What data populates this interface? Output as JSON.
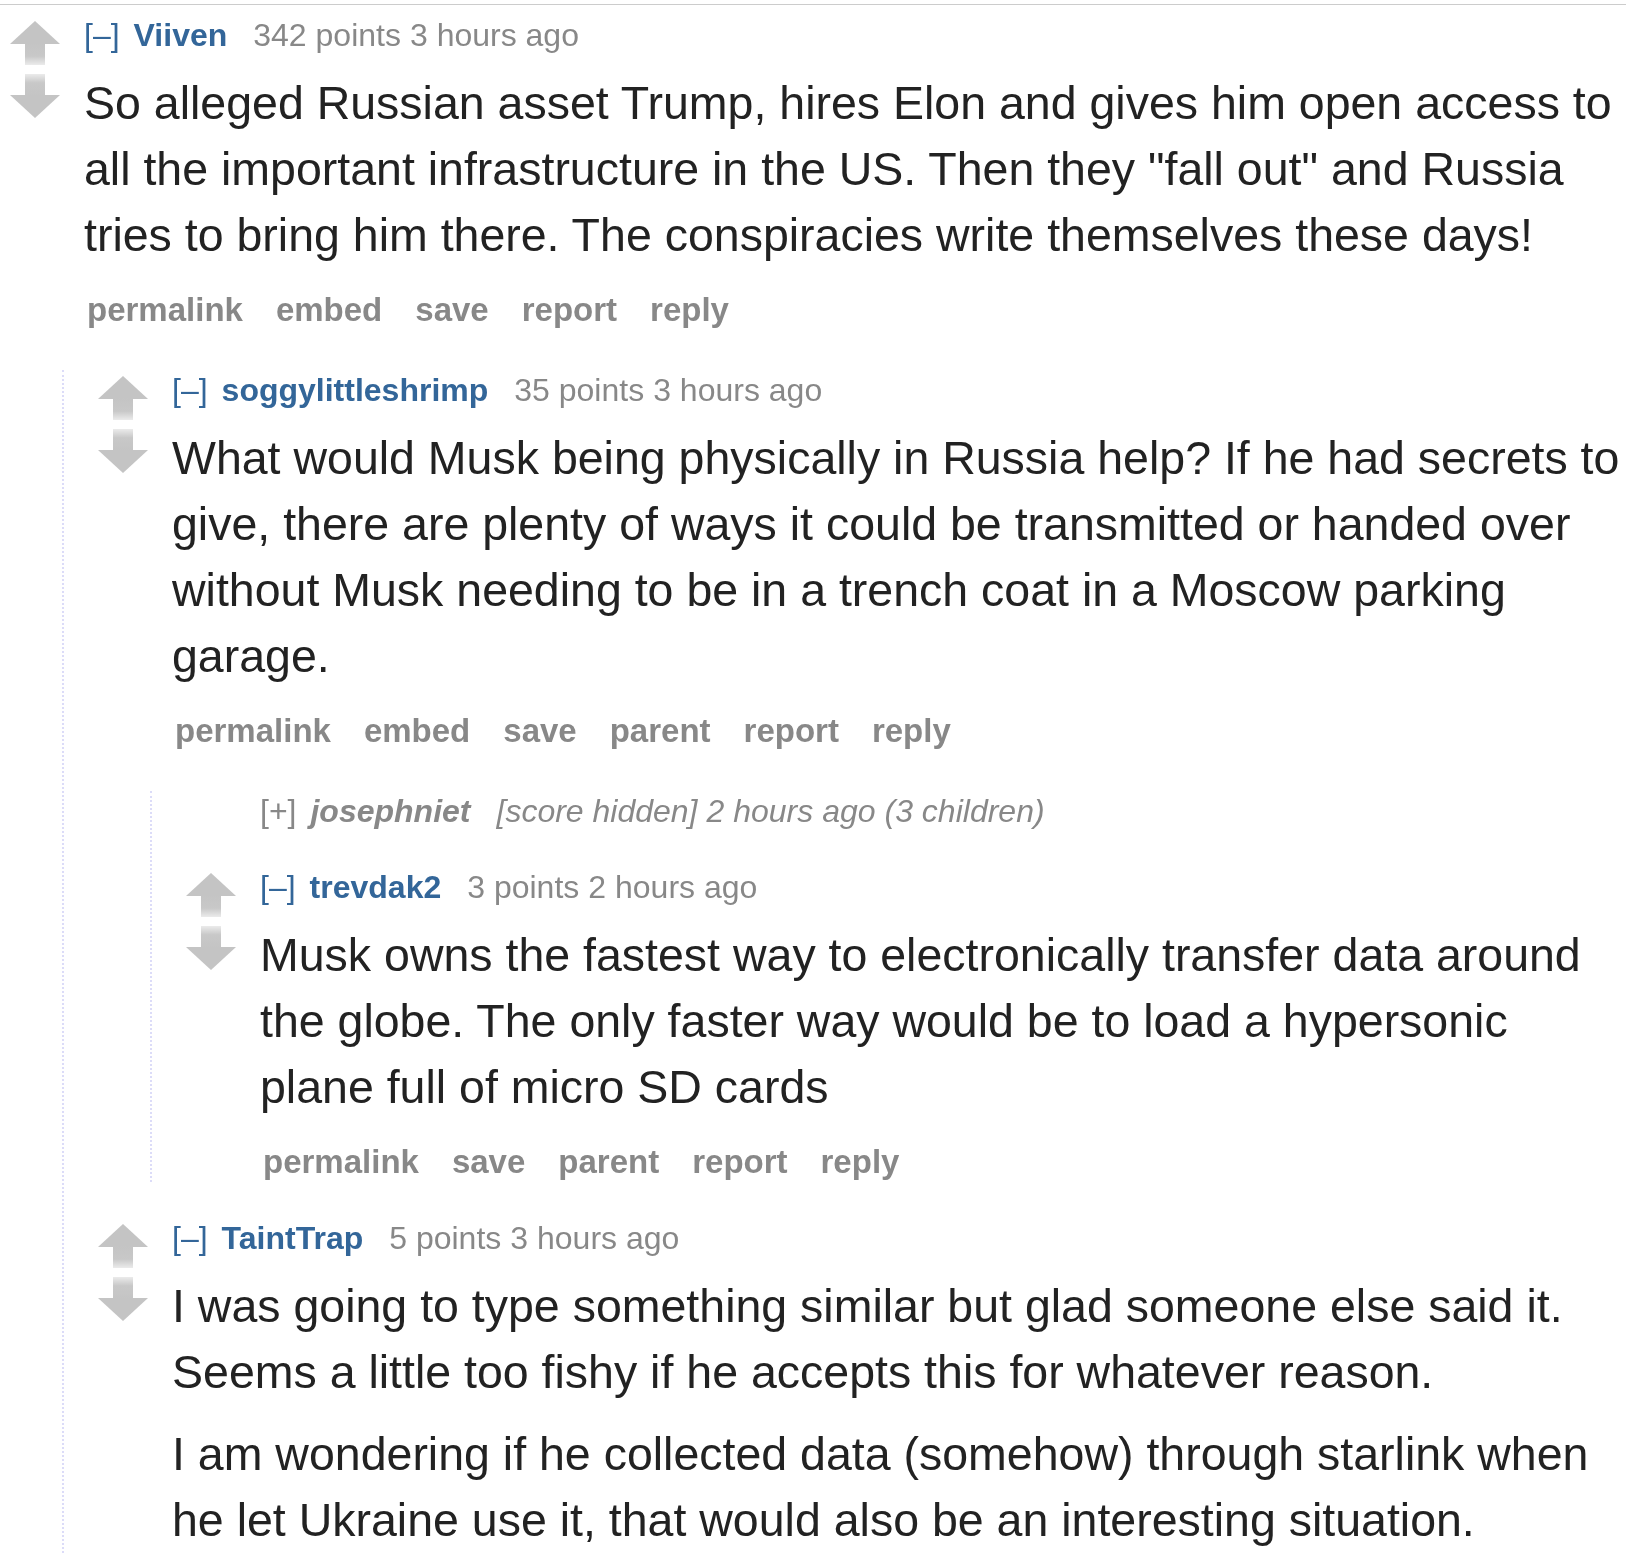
{
  "comments": [
    {
      "toggle": "[–]",
      "author": "Viiven",
      "score": "342 points",
      "time": "3 hours ago",
      "collapsed": false,
      "paragraphs": [
        "So alleged Russian asset Trump, hires Elon and gives him open access to all the important infrastructure in the US. Then they \"fall out\" and Russia tries to bring him there. The conspiracies write themselves these days!"
      ],
      "buttons": [
        "permalink",
        "embed",
        "save",
        "report",
        "reply"
      ],
      "children": [
        {
          "toggle": "[–]",
          "author": "soggylittleshrimp",
          "score": "35 points",
          "time": "3 hours ago",
          "collapsed": false,
          "paragraphs": [
            "What would Musk being physically in Russia help? If he had secrets to give, there are plenty of ways it could be transmitted or handed over without Musk needing to be in a trench coat in a Moscow parking garage."
          ],
          "buttons": [
            "permalink",
            "embed",
            "save",
            "parent",
            "report",
            "reply"
          ],
          "children": [
            {
              "toggle": "[+]",
              "author": "josephniet",
              "score": "[score hidden]",
              "time": "2 hours ago",
              "child_count": "(3 children)",
              "collapsed": true
            },
            {
              "toggle": "[–]",
              "author": "trevdak2",
              "score": "3 points",
              "time": "2 hours ago",
              "collapsed": false,
              "paragraphs": [
                "Musk owns the fastest way to electronically transfer data around the globe. The only faster way would be to load a hypersonic plane full of micro SD cards"
              ],
              "buttons": [
                "permalink",
                "save",
                "parent",
                "report",
                "reply"
              ]
            }
          ]
        },
        {
          "toggle": "[–]",
          "author": "TaintTrap",
          "score": "5 points",
          "time": "3 hours ago",
          "collapsed": false,
          "paragraphs": [
            "I was going to type something similar but glad someone else said it. Seems a little too fishy if he accepts this for whatever reason.",
            "I am wondering if he collected data (somehow) through starlink when he let Ukraine use it, that would also be an interesting situation."
          ]
        }
      ]
    }
  ]
}
